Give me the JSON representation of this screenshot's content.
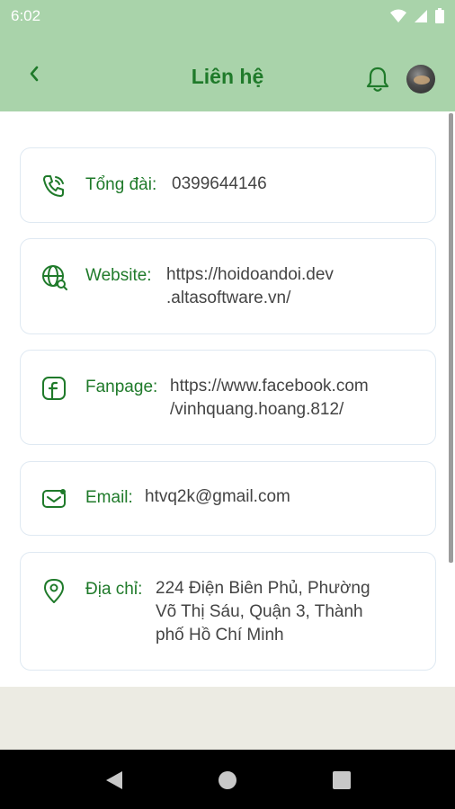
{
  "status_bar": {
    "time": "6:02",
    "icons": [
      "wifi-icon",
      "cell-signal-icon",
      "battery-icon"
    ]
  },
  "header": {
    "title": "Liên hệ",
    "back_icon": "chevron-left-icon",
    "bell_icon": "bell-icon",
    "avatar": "user-avatar"
  },
  "contacts": [
    {
      "icon": "phone-call-icon",
      "label": "Tổng đài:",
      "value": "0399644146"
    },
    {
      "icon": "globe-search-icon",
      "label": "Website:",
      "value_lines": [
        "https://hoidoandoi.dev",
        ".altasoftware.vn/"
      ]
    },
    {
      "icon": "facebook-icon",
      "label": "Fanpage:",
      "value_lines": [
        "https://www.facebook.com",
        "/vinhquang.hoang.812/"
      ]
    },
    {
      "icon": "mail-icon",
      "label": "Email:",
      "value": "htvq2k@gmail.com"
    },
    {
      "icon": "location-pin-icon",
      "label": "Địa chỉ:",
      "value_lines": [
        "224 Điện Biên Phủ, Phường",
        "Võ Thị Sáu, Quận 3, Thành",
        "phố Hồ Chí Minh"
      ]
    }
  ],
  "colors": {
    "app_bar": "#a9d3aa",
    "accent_green": "#1f7a2a",
    "card_border": "#dfe9f2",
    "text_value": "#444444",
    "footer": "#ecebe3",
    "nav_bar": "#000000"
  },
  "nav": {
    "back_icon": "nav-back-triangle-icon",
    "home_icon": "nav-home-circle-icon",
    "recents_icon": "nav-recents-square-icon"
  }
}
